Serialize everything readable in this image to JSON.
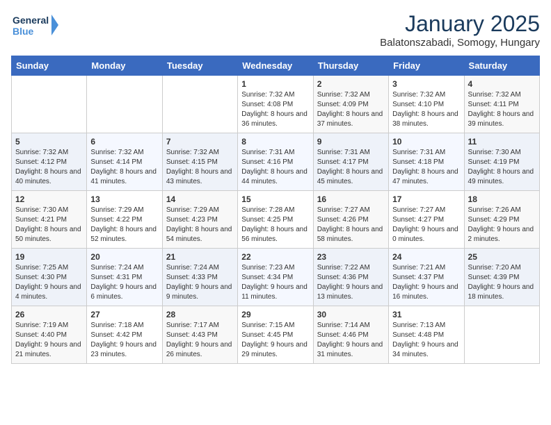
{
  "header": {
    "logo_line1": "General",
    "logo_line2": "Blue",
    "title": "January 2025",
    "subtitle": "Balatonszabadi, Somogy, Hungary"
  },
  "days_of_week": [
    "Sunday",
    "Monday",
    "Tuesday",
    "Wednesday",
    "Thursday",
    "Friday",
    "Saturday"
  ],
  "weeks": [
    {
      "cells": [
        {
          "day": null,
          "info": null
        },
        {
          "day": null,
          "info": null
        },
        {
          "day": null,
          "info": null
        },
        {
          "day": "1",
          "info": "Sunrise: 7:32 AM\nSunset: 4:08 PM\nDaylight: 8 hours and 36 minutes."
        },
        {
          "day": "2",
          "info": "Sunrise: 7:32 AM\nSunset: 4:09 PM\nDaylight: 8 hours and 37 minutes."
        },
        {
          "day": "3",
          "info": "Sunrise: 7:32 AM\nSunset: 4:10 PM\nDaylight: 8 hours and 38 minutes."
        },
        {
          "day": "4",
          "info": "Sunrise: 7:32 AM\nSunset: 4:11 PM\nDaylight: 8 hours and 39 minutes."
        }
      ]
    },
    {
      "cells": [
        {
          "day": "5",
          "info": "Sunrise: 7:32 AM\nSunset: 4:12 PM\nDaylight: 8 hours and 40 minutes."
        },
        {
          "day": "6",
          "info": "Sunrise: 7:32 AM\nSunset: 4:14 PM\nDaylight: 8 hours and 41 minutes."
        },
        {
          "day": "7",
          "info": "Sunrise: 7:32 AM\nSunset: 4:15 PM\nDaylight: 8 hours and 43 minutes."
        },
        {
          "day": "8",
          "info": "Sunrise: 7:31 AM\nSunset: 4:16 PM\nDaylight: 8 hours and 44 minutes."
        },
        {
          "day": "9",
          "info": "Sunrise: 7:31 AM\nSunset: 4:17 PM\nDaylight: 8 hours and 45 minutes."
        },
        {
          "day": "10",
          "info": "Sunrise: 7:31 AM\nSunset: 4:18 PM\nDaylight: 8 hours and 47 minutes."
        },
        {
          "day": "11",
          "info": "Sunrise: 7:30 AM\nSunset: 4:19 PM\nDaylight: 8 hours and 49 minutes."
        }
      ]
    },
    {
      "cells": [
        {
          "day": "12",
          "info": "Sunrise: 7:30 AM\nSunset: 4:21 PM\nDaylight: 8 hours and 50 minutes."
        },
        {
          "day": "13",
          "info": "Sunrise: 7:29 AM\nSunset: 4:22 PM\nDaylight: 8 hours and 52 minutes."
        },
        {
          "day": "14",
          "info": "Sunrise: 7:29 AM\nSunset: 4:23 PM\nDaylight: 8 hours and 54 minutes."
        },
        {
          "day": "15",
          "info": "Sunrise: 7:28 AM\nSunset: 4:25 PM\nDaylight: 8 hours and 56 minutes."
        },
        {
          "day": "16",
          "info": "Sunrise: 7:27 AM\nSunset: 4:26 PM\nDaylight: 8 hours and 58 minutes."
        },
        {
          "day": "17",
          "info": "Sunrise: 7:27 AM\nSunset: 4:27 PM\nDaylight: 9 hours and 0 minutes."
        },
        {
          "day": "18",
          "info": "Sunrise: 7:26 AM\nSunset: 4:29 PM\nDaylight: 9 hours and 2 minutes."
        }
      ]
    },
    {
      "cells": [
        {
          "day": "19",
          "info": "Sunrise: 7:25 AM\nSunset: 4:30 PM\nDaylight: 9 hours and 4 minutes."
        },
        {
          "day": "20",
          "info": "Sunrise: 7:24 AM\nSunset: 4:31 PM\nDaylight: 9 hours and 6 minutes."
        },
        {
          "day": "21",
          "info": "Sunrise: 7:24 AM\nSunset: 4:33 PM\nDaylight: 9 hours and 9 minutes."
        },
        {
          "day": "22",
          "info": "Sunrise: 7:23 AM\nSunset: 4:34 PM\nDaylight: 9 hours and 11 minutes."
        },
        {
          "day": "23",
          "info": "Sunrise: 7:22 AM\nSunset: 4:36 PM\nDaylight: 9 hours and 13 minutes."
        },
        {
          "day": "24",
          "info": "Sunrise: 7:21 AM\nSunset: 4:37 PM\nDaylight: 9 hours and 16 minutes."
        },
        {
          "day": "25",
          "info": "Sunrise: 7:20 AM\nSunset: 4:39 PM\nDaylight: 9 hours and 18 minutes."
        }
      ]
    },
    {
      "cells": [
        {
          "day": "26",
          "info": "Sunrise: 7:19 AM\nSunset: 4:40 PM\nDaylight: 9 hours and 21 minutes."
        },
        {
          "day": "27",
          "info": "Sunrise: 7:18 AM\nSunset: 4:42 PM\nDaylight: 9 hours and 23 minutes."
        },
        {
          "day": "28",
          "info": "Sunrise: 7:17 AM\nSunset: 4:43 PM\nDaylight: 9 hours and 26 minutes."
        },
        {
          "day": "29",
          "info": "Sunrise: 7:15 AM\nSunset: 4:45 PM\nDaylight: 9 hours and 29 minutes."
        },
        {
          "day": "30",
          "info": "Sunrise: 7:14 AM\nSunset: 4:46 PM\nDaylight: 9 hours and 31 minutes."
        },
        {
          "day": "31",
          "info": "Sunrise: 7:13 AM\nSunset: 4:48 PM\nDaylight: 9 hours and 34 minutes."
        },
        {
          "day": null,
          "info": null
        }
      ]
    }
  ]
}
